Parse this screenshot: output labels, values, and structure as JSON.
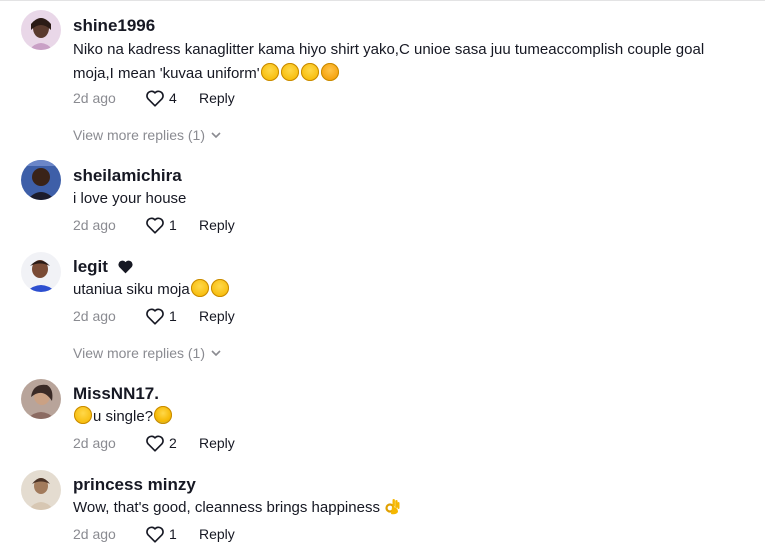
{
  "comments": [
    {
      "username": "shine1996",
      "text": "Niko na kadress kanaglitter kama hiyo shirt yako,C unioe sasa juu tumeaccomplish couple goal moja,I mean 'kuvaa uniform'",
      "time": "2d ago",
      "likes": "4",
      "reply": "Reply",
      "more_replies": "View more replies (1)"
    },
    {
      "username": "sheilamichira",
      "text": "i love your house",
      "time": "2d ago",
      "likes": "1",
      "reply": "Reply"
    },
    {
      "username": "legit",
      "text": "utaniua siku moja",
      "time": "2d ago",
      "likes": "1",
      "reply": "Reply",
      "more_replies": "View more replies (1)"
    },
    {
      "username": "MissNN17.",
      "text_pre": "",
      "text": "u single?",
      "time": "2d ago",
      "likes": "2",
      "reply": "Reply"
    },
    {
      "username": "princess minzy",
      "text": "Wow, that's good, cleanness brings happiness",
      "time": "2d ago",
      "likes": "1",
      "reply": "Reply"
    }
  ],
  "icons": {
    "like": "heart-outline-icon",
    "expand": "chevron-down-icon",
    "emoji_laugh": "tears-of-joy-emoji-icon",
    "emoji_hearts": "smiling-face-with-hearts-emoji-icon",
    "emoji_cry": "loudly-crying-emoji-icon",
    "emoji_ok": "ok-hand-emoji-icon",
    "name_badge": "black-heart-icon"
  },
  "colors": {
    "text": "#161823",
    "muted": "#8a8b91"
  }
}
